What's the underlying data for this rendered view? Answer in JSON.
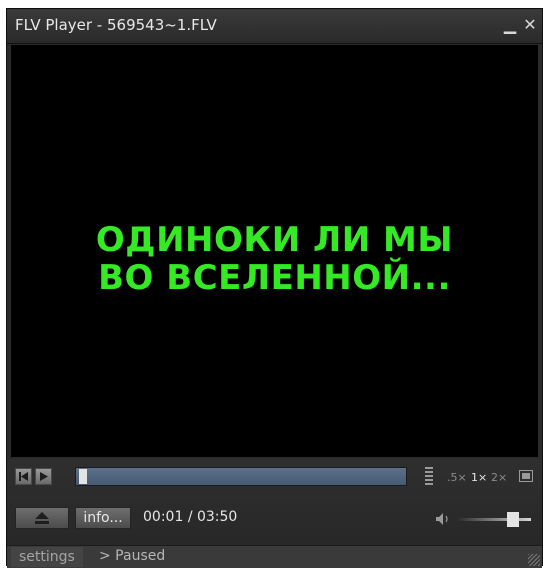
{
  "window": {
    "title": "FLV Player - 569543~1.FLV",
    "minimize_icon": "minimize-icon",
    "close_icon": "close-icon"
  },
  "video": {
    "subtitle_line1": "ОДИНОКИ ЛИ МЫ",
    "subtitle_line2": "ВО ВСЕЛЕННОЙ...",
    "subtitle_color": "#35ea24"
  },
  "controls": {
    "seek_progress": 0.004,
    "speed_options": [
      ".5×",
      "1×",
      "2×"
    ],
    "selected_speed": "1×",
    "eject_icon": "eject-icon",
    "info_label": "info...",
    "time_current": "00:01",
    "time_separator": "/",
    "time_total": "03:50",
    "volume_level": 0.8
  },
  "statusbar": {
    "settings_label": "settings",
    "status_text": "> Paused"
  }
}
